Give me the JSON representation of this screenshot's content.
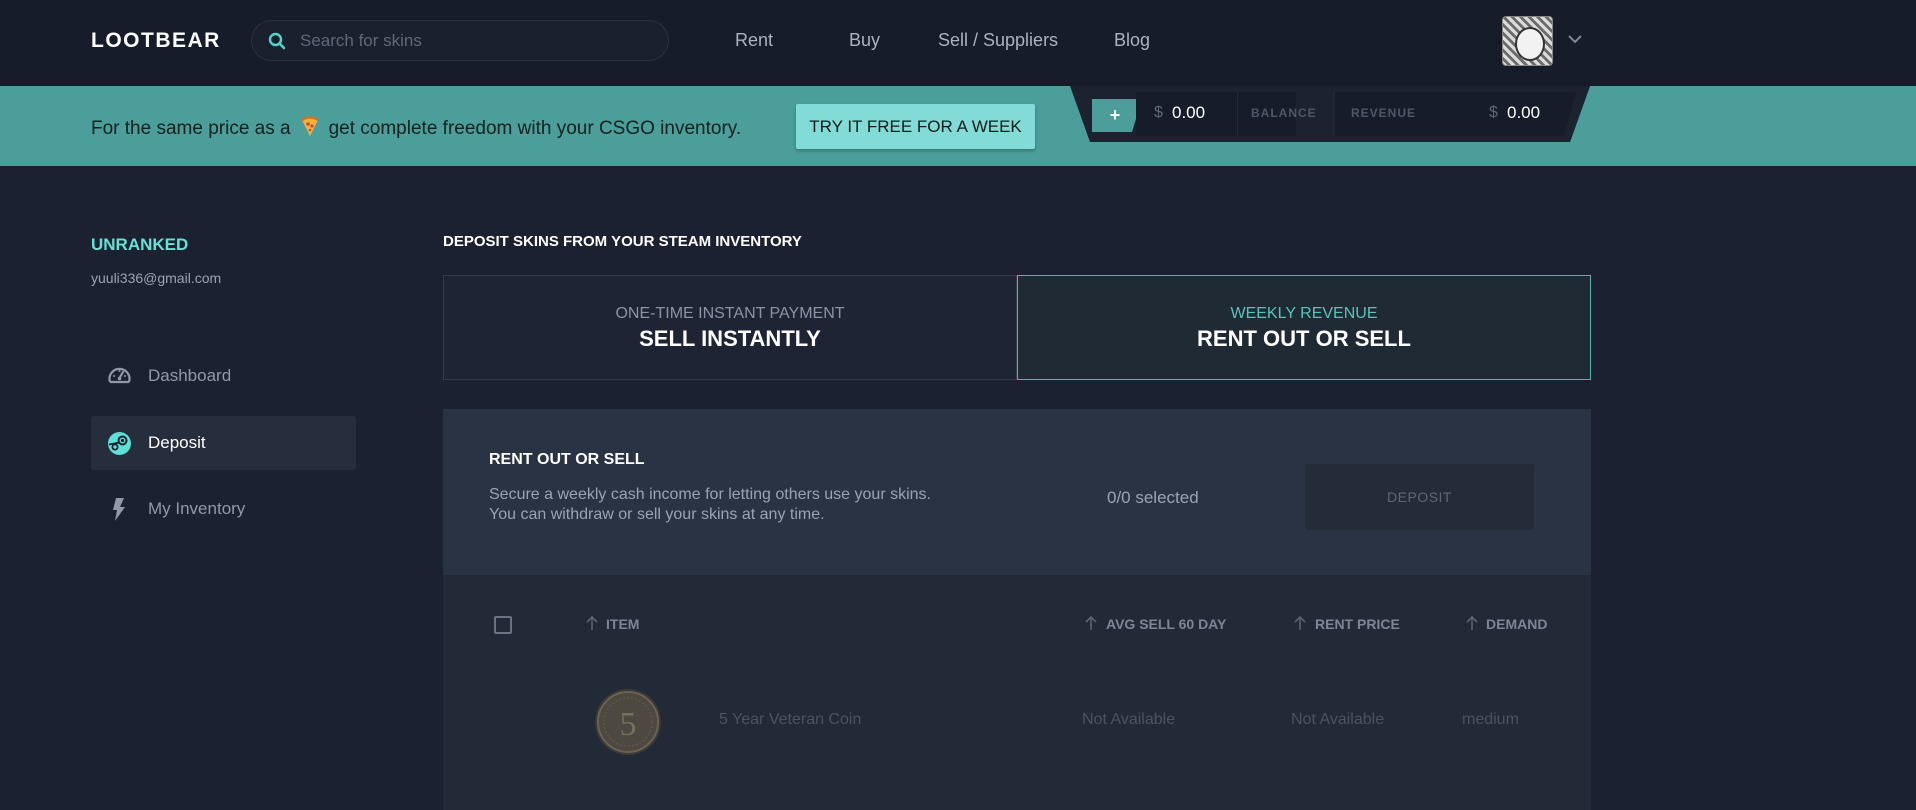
{
  "header": {
    "logo": "LOOTBEAR",
    "search_placeholder": "Search for skins",
    "nav": [
      "Rent",
      "Buy",
      "Sell / Suppliers",
      "Blog"
    ]
  },
  "promo": {
    "text_before": "For the same price as a",
    "text_after": "get complete freedom with your CSGO inventory.",
    "cta": "TRY IT FREE FOR A WEEK"
  },
  "wallet": {
    "add": "+",
    "currency": "$",
    "balance_amount": "0.00",
    "balance_label": "BALANCE",
    "revenue_label": "REVENUE",
    "revenue_amount": "0.00"
  },
  "sidebar": {
    "rank": "UNRANKED",
    "email": "yuuli336@gmail.com",
    "items": [
      {
        "label": "Dashboard",
        "icon": "gauge-icon"
      },
      {
        "label": "Deposit",
        "icon": "steam-icon"
      },
      {
        "label": "My Inventory",
        "icon": "lightning-icon"
      }
    ]
  },
  "main": {
    "section_title": "DEPOSIT SKINS FROM YOUR STEAM INVENTORY",
    "modes": [
      {
        "sub": "ONE-TIME INSTANT PAYMENT",
        "main": "SELL INSTANTLY"
      },
      {
        "sub": "WEEKLY REVENUE",
        "main": "RENT OUT OR SELL"
      }
    ],
    "panel": {
      "title": "RENT OUT OR SELL",
      "description": "Secure a weekly cash income for letting others use your skins. You can withdraw or sell your skins at any time.",
      "selected": "0/0 selected",
      "deposit": "DEPOSIT"
    },
    "table": {
      "columns": [
        "ITEM",
        "AVG SELL 60 DAY",
        "RENT PRICE",
        "DEMAND"
      ],
      "rows": [
        {
          "item": "5 Year Veteran Coin",
          "avg_sell": "Not Available",
          "rent_price": "Not Available",
          "demand": "medium"
        }
      ]
    }
  },
  "colors": {
    "accent": "#4ab8b0",
    "promo_bg": "#4b9e9a",
    "page_bg": "#1b2130"
  }
}
